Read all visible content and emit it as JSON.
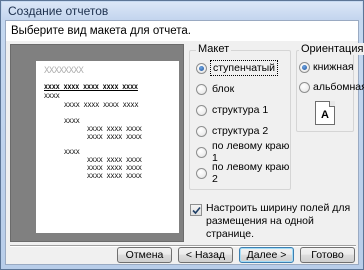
{
  "window": {
    "title": "Создание отчетов"
  },
  "prompt": "Выберите вид макета для отчета.",
  "preview": {
    "title": "XXXXXXXX",
    "header_row": "XXXX XXXX XXXX XXXX XXXX",
    "group1": "XXXX",
    "row_a": "XXXX XXXX XXXX XXXX",
    "group2": "XXXX",
    "row_b": "XXXX XXXX XXXX",
    "row_c": "XXXX XXXX XXXX",
    "group3": "XXXX",
    "row_d": "XXXX XXXX XXXX",
    "row_e": "XXXX XXXX XXXX",
    "row_f": "XXXX XXXX XXXX"
  },
  "layout_group": {
    "legend": "Макет",
    "options": [
      {
        "label": "ступенчатый",
        "selected": true
      },
      {
        "label": "блок",
        "selected": false
      },
      {
        "label": "структура 1",
        "selected": false
      },
      {
        "label": "структура 2",
        "selected": false
      },
      {
        "label": "по левому краю 1",
        "selected": false
      },
      {
        "label": "по левому краю 2",
        "selected": false
      }
    ]
  },
  "orientation_group": {
    "legend": "Ориентация",
    "options": [
      {
        "label": "книжная",
        "selected": true
      },
      {
        "label": "альбомная",
        "selected": false
      }
    ],
    "page_icon_letter": "A"
  },
  "fit_checkbox": {
    "checked": true,
    "line1": "Настроить ширину полей для",
    "line2": "размещения на одной странице."
  },
  "buttons": {
    "cancel": "Отмена",
    "back": "< Назад",
    "next": "Далее >",
    "finish": "Готово"
  }
}
